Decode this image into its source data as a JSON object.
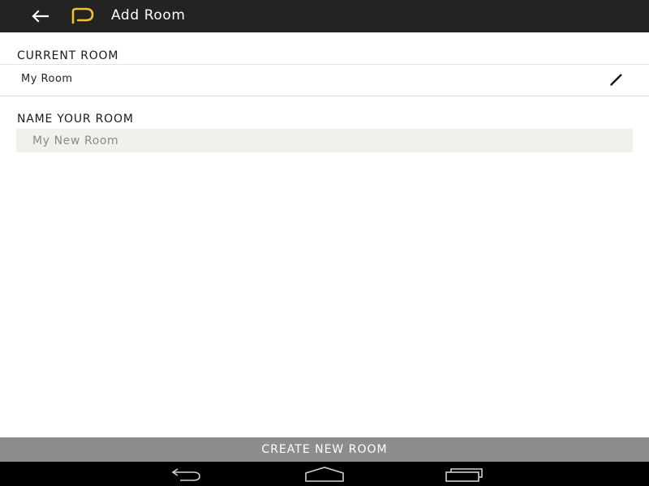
{
  "appbar": {
    "title": "Add Room",
    "back_icon": "arrow-left-icon",
    "logo_icon": "app-logo-icon",
    "logo_color": "#f2c230",
    "background": "#232323"
  },
  "current_room": {
    "label": "CURRENT ROOM",
    "value": "My Room",
    "edit_icon": "pencil-icon"
  },
  "name_room": {
    "label": "NAME YOUR ROOM",
    "placeholder": "My New Room",
    "value": ""
  },
  "create_button": {
    "label": "CREATE NEW ROOM",
    "background": "#8d8d8d"
  },
  "system_nav": {
    "back_icon": "nav-back-icon",
    "home_icon": "nav-home-icon",
    "recents_icon": "nav-recents-icon"
  }
}
